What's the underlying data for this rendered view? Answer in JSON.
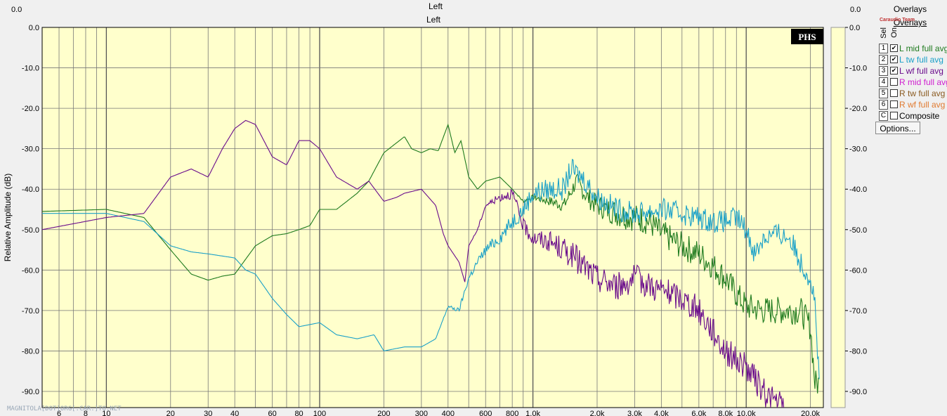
{
  "window": {
    "outer_title": "Left",
    "ghost_tick_left": "0.0",
    "ghost_tick_right": "0.0"
  },
  "panel": {
    "title": "Overlays",
    "tab": "Overlays",
    "header_sel": "Sel",
    "header_on": "On",
    "options_label": "Options...",
    "watermark": "Caraudio Team",
    "rows": [
      {
        "key": "1",
        "label": "L mid full avg",
        "checked": true,
        "color": "#1e7a1e"
      },
      {
        "key": "2",
        "label": "L tw full avg",
        "checked": true,
        "color": "#1aa0c8"
      },
      {
        "key": "3",
        "label": "L wf full avg",
        "checked": true,
        "color": "#6a0c8c"
      },
      {
        "key": "4",
        "label": "R mid full avg",
        "checked": false,
        "color": "#d020d0"
      },
      {
        "key": "5",
        "label": "R tw full avg",
        "checked": false,
        "color": "#8a5a20"
      },
      {
        "key": "6",
        "label": "R wf full avg",
        "checked": false,
        "color": "#e07a30"
      },
      {
        "key": "C",
        "label": "Composite",
        "checked": false,
        "color": "#000000"
      }
    ]
  },
  "footer": "MAGNITOLA[DOT]ORG[.CAR.]TO.NET",
  "chart_data": {
    "type": "line",
    "title": "Left",
    "ylabel": "Relative Amplitude (dB)",
    "xlabel": "",
    "x_scale": "log",
    "xlim": [
      5,
      23000
    ],
    "ylim": [
      -94,
      0
    ],
    "badge": "PHS",
    "y_ticks": [
      "0.0",
      "-10.0",
      "-20.0",
      "-30.0",
      "-40.0",
      "-50.0",
      "-60.0",
      "-70.0",
      "-80.0",
      "-90.0"
    ],
    "y_tick_values": [
      0,
      -10,
      -20,
      -30,
      -40,
      -50,
      -60,
      -70,
      -80,
      -90
    ],
    "x_ticks": [
      {
        "v": 6,
        "t": "6"
      },
      {
        "v": 8,
        "t": "8"
      },
      {
        "v": 10,
        "t": "10"
      },
      {
        "v": 20,
        "t": "20"
      },
      {
        "v": 30,
        "t": "30"
      },
      {
        "v": 40,
        "t": "40"
      },
      {
        "v": 60,
        "t": "60"
      },
      {
        "v": 80,
        "t": "80"
      },
      {
        "v": 100,
        "t": "100"
      },
      {
        "v": 200,
        "t": "200"
      },
      {
        "v": 300,
        "t": "300"
      },
      {
        "v": 400,
        "t": "400"
      },
      {
        "v": 600,
        "t": "600"
      },
      {
        "v": 800,
        "t": "800"
      },
      {
        "v": 1000,
        "t": "1.0k"
      },
      {
        "v": 2000,
        "t": "2.0k"
      },
      {
        "v": 3000,
        "t": "3.0k"
      },
      {
        "v": 4000,
        "t": "4.0k"
      },
      {
        "v": 6000,
        "t": "6.0k"
      },
      {
        "v": 8000,
        "t": "8.0k"
      },
      {
        "v": 10000,
        "t": "10.0k"
      },
      {
        "v": 20000,
        "t": "20.0k"
      }
    ],
    "grid": true,
    "series": [
      {
        "name": "L mid full avg",
        "color": "#1e7a1e",
        "noise_start": 800,
        "noise_amp": 3.5,
        "x": [
          5,
          10,
          15,
          20,
          25,
          30,
          35,
          40,
          50,
          60,
          70,
          80,
          90,
          100,
          120,
          150,
          170,
          200,
          230,
          250,
          270,
          300,
          330,
          360,
          400,
          430,
          460,
          500,
          550,
          600,
          700,
          800,
          900,
          1000,
          1200,
          1400,
          1600,
          1800,
          2000,
          2500,
          3000,
          3500,
          4000,
          5000,
          6000,
          7000,
          8000,
          9000,
          10000,
          12000,
          15000,
          18000,
          20000,
          21000,
          22000
        ],
        "y": [
          -45.5,
          -45,
          -47,
          -55,
          -61,
          -62.5,
          -61.5,
          -61,
          -54,
          -51.5,
          -51,
          -50,
          -49,
          -45,
          -45,
          -41,
          -38,
          -31,
          -28.5,
          -27,
          -30,
          -31,
          -30,
          -30.5,
          -24,
          -31,
          -28,
          -37,
          -40,
          -38,
          -37,
          -40,
          -43,
          -42,
          -43,
          -44,
          -38,
          -42,
          -44,
          -46,
          -47,
          -48,
          -51,
          -54,
          -56,
          -59,
          -62,
          -66,
          -69,
          -70,
          -70,
          -70,
          -74,
          -88,
          -88
        ]
      },
      {
        "name": "L tw full avg",
        "color": "#1aa0c8",
        "noise_start": 350,
        "noise_amp": 2.8,
        "x": [
          5,
          10,
          15,
          20,
          25,
          30,
          40,
          45,
          50,
          60,
          70,
          80,
          100,
          120,
          150,
          180,
          200,
          250,
          300,
          350,
          400,
          450,
          500,
          550,
          600,
          700,
          800,
          900,
          1000,
          1200,
          1400,
          1500,
          1700,
          2000,
          2500,
          3000,
          4000,
          5000,
          6000,
          7000,
          8000,
          9000,
          10000,
          11000,
          12000,
          14000,
          16000,
          18000,
          20000,
          21000,
          22000
        ],
        "y": [
          -46,
          -46,
          -48,
          -54,
          -55.5,
          -56,
          -57,
          -60,
          -61,
          -67,
          -71,
          -74,
          -73,
          -76,
          -77,
          -76,
          -80,
          -79,
          -79,
          -77,
          -69,
          -70,
          -62,
          -58,
          -55,
          -52,
          -48,
          -45,
          -41,
          -40,
          -40,
          -35,
          -37,
          -42,
          -45,
          -46,
          -45,
          -46,
          -47,
          -48,
          -48,
          -47,
          -50,
          -56,
          -52,
          -51,
          -52,
          -58,
          -62,
          -68,
          -88
        ]
      },
      {
        "name": "L wf full avg",
        "color": "#6a0c8c",
        "noise_start": 500,
        "noise_amp": 3.5,
        "x": [
          5,
          10,
          15,
          20,
          25,
          30,
          35,
          40,
          45,
          50,
          60,
          70,
          80,
          90,
          100,
          120,
          150,
          170,
          200,
          230,
          250,
          300,
          350,
          380,
          400,
          450,
          480,
          500,
          550,
          600,
          700,
          800,
          900,
          1000,
          1200,
          1500,
          2000,
          2500,
          3000,
          4000,
          5000,
          6000,
          7000,
          8000,
          10000,
          12000,
          15000
        ],
        "y": [
          -50,
          -47,
          -46,
          -37,
          -35,
          -37,
          -30,
          -25,
          -23,
          -24,
          -32,
          -34,
          -28,
          -28,
          -30,
          -37,
          -40,
          -38,
          -43,
          -42,
          -41,
          -40,
          -44,
          -51,
          -54,
          -58,
          -63,
          -54,
          -50,
          -44,
          -42,
          -41,
          -49,
          -52,
          -53,
          -56,
          -62,
          -64,
          -62,
          -65,
          -67,
          -70,
          -75,
          -80,
          -84,
          -90,
          -94
        ]
      }
    ]
  }
}
